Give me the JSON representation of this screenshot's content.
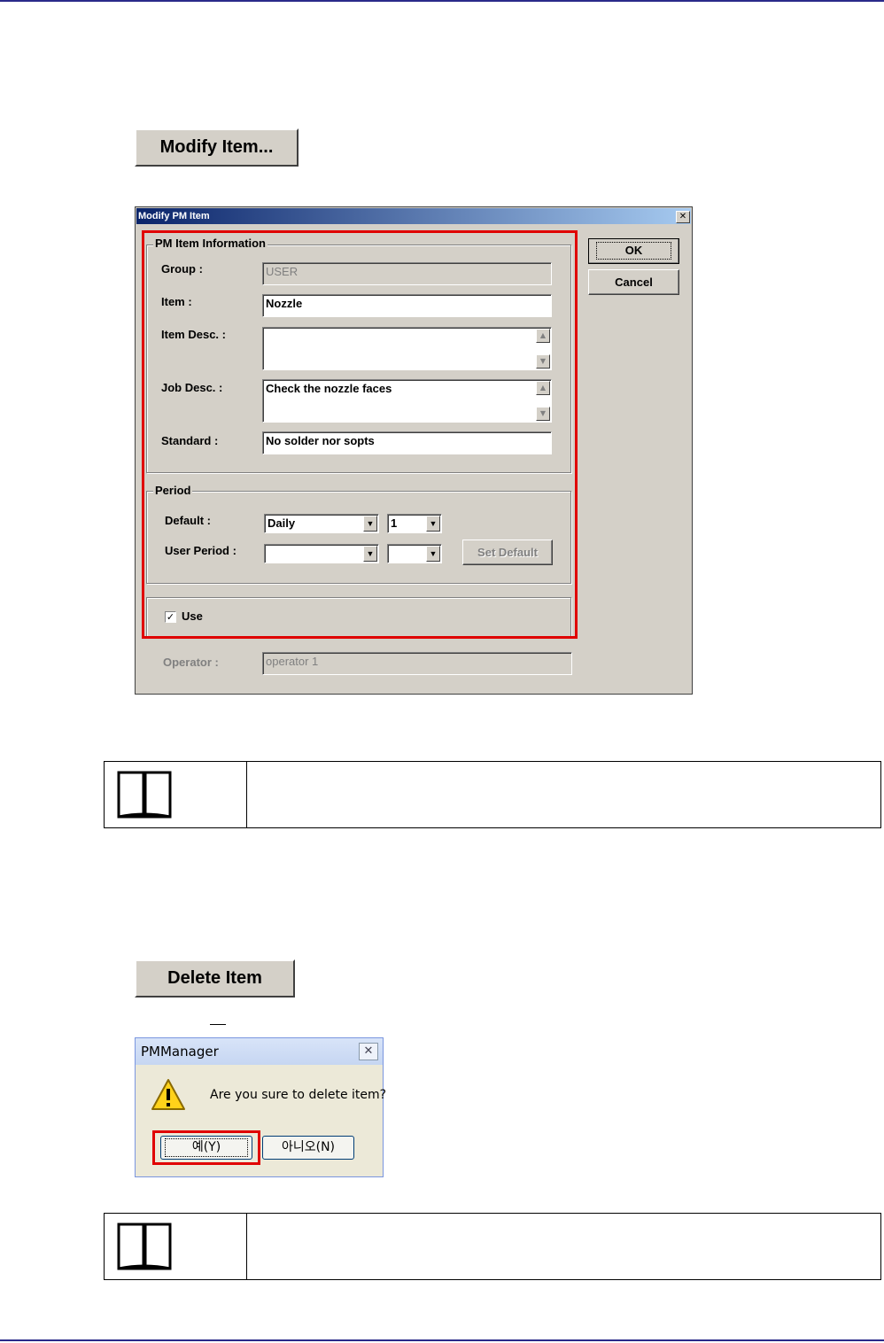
{
  "modify_button_label": "Modify Item...",
  "modify_dialog": {
    "title": "Modify PM Item",
    "close_glyph": "✕",
    "info_group_title": "PM Item Information",
    "group_label": "Group :",
    "group_value": "USER",
    "item_label": "Item :",
    "item_value": "Nozzle",
    "item_desc_label": "Item Desc. :",
    "item_desc_value": "",
    "job_desc_label": "Job Desc. :",
    "job_desc_value": "Check the nozzle faces",
    "standard_label": "Standard :",
    "standard_value": "No solder nor sopts",
    "period_group_title": "Period",
    "default_label": "Default :",
    "default_period": "Daily",
    "default_count": "1",
    "user_period_label": "User Period :",
    "user_period": "",
    "user_count": "",
    "set_default_label": "Set Default",
    "use_label": "Use",
    "use_checked": true,
    "operator_label": "Operator :",
    "operator_value": "operator 1",
    "ok_label": "OK",
    "cancel_label": "Cancel"
  },
  "delete_button_label": "Delete Item",
  "delete_dialog": {
    "title": "PMManager",
    "close_glyph": "✕",
    "message": "Are you sure to delete item?",
    "yes_label": "예(Y)",
    "no_label": "아니오(N)",
    "icon": "warning-icon"
  },
  "note_icon": "open-book-icon",
  "colors": {
    "highlight": "#e00000",
    "rule": "#2a2a8a",
    "dialog_face": "#d4d0c8"
  }
}
